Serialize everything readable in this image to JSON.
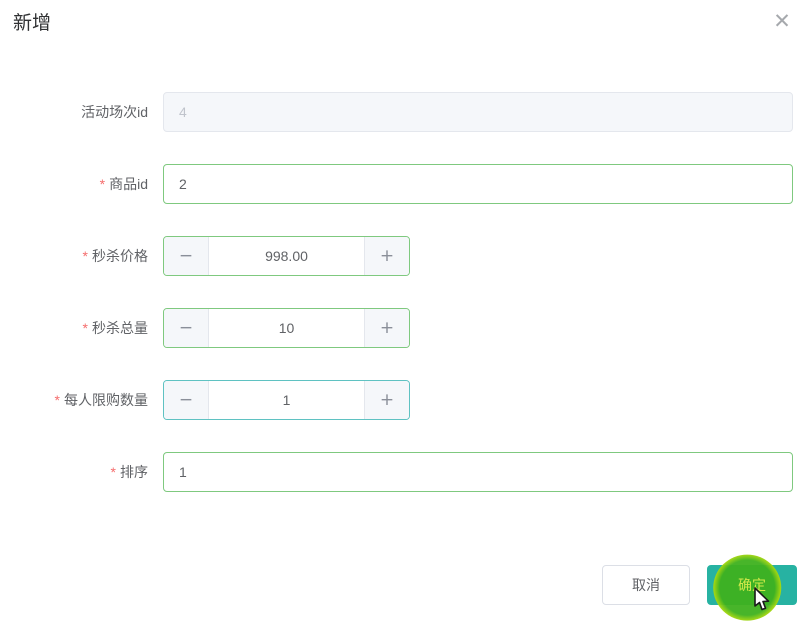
{
  "dialog": {
    "title": "新增",
    "close_glyph": "✕"
  },
  "form": {
    "required_marker": "*",
    "stepper_glyphs": {
      "decrease": "−",
      "increase": "+"
    },
    "fields": [
      {
        "label": "活动场次id",
        "required": false,
        "control": "text-input",
        "value": "4",
        "state": "disabled"
      },
      {
        "label": "商品id",
        "required": true,
        "control": "text-input",
        "value": "2",
        "state": "success"
      },
      {
        "label": "秒杀价格",
        "required": true,
        "control": "number-stepper",
        "value": "998.00",
        "state": "success"
      },
      {
        "label": "秒杀总量",
        "required": true,
        "control": "number-stepper",
        "value": "10",
        "state": "success"
      },
      {
        "label": "每人限购数量",
        "required": true,
        "control": "number-stepper",
        "value": "1",
        "state": "focus"
      },
      {
        "label": "排序",
        "required": true,
        "control": "text-input",
        "value": "1",
        "state": "success"
      }
    ]
  },
  "footer": {
    "cancel_label": "取消",
    "confirm_label": "确定"
  },
  "colors": {
    "success_border": "#7fc97f",
    "focus_border": "#5fc2c2",
    "confirm_button_bg": "#27b2a2",
    "required_asterisk": "#f56c6c",
    "disabled_bg": "#f5f7fa",
    "click_highlight_inner": "#3eb11e",
    "click_highlight_ring": "#e4ef00"
  }
}
